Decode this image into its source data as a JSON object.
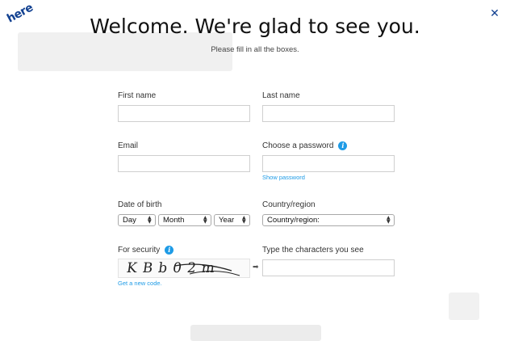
{
  "header": {
    "logo_text": "here",
    "title": "Welcome. We're glad to see you.",
    "subtitle": "Please fill in all the boxes."
  },
  "form": {
    "first_name": {
      "label": "First name",
      "value": "",
      "placeholder": ""
    },
    "last_name": {
      "label": "Last name",
      "value": "",
      "placeholder": ""
    },
    "email": {
      "label": "Email",
      "value": "",
      "placeholder": ""
    },
    "password": {
      "label": "Choose a password",
      "value": "",
      "show_password_link": "Show password"
    },
    "date_of_birth": {
      "label": "Date of birth",
      "day": "Day",
      "month": "Month",
      "year": "Year"
    },
    "country": {
      "label": "Country/region",
      "selected": "Country/region:"
    },
    "security": {
      "label": "For security",
      "captcha_text": "KBb02m",
      "new_code_link": "Get a new code.",
      "type_label": "Type the characters you see",
      "value": ""
    }
  },
  "icons": {
    "info": "info-icon",
    "close": "close-icon",
    "arrow": "arrow-right-icon"
  },
  "colors": {
    "brand": "#124191",
    "link": "#1e9be6",
    "border": "#cfcfcf"
  }
}
